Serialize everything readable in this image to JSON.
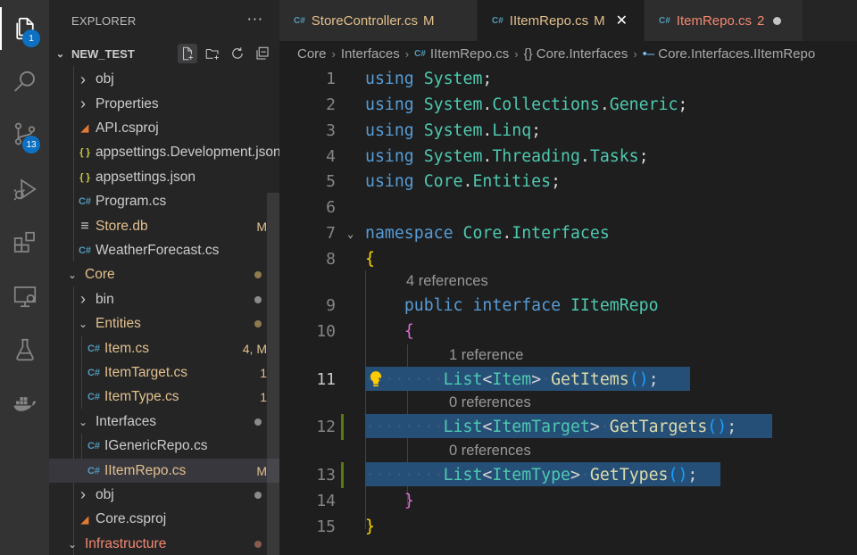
{
  "activity_bar": {
    "explorer_badge": "1",
    "source_control_badge": "13"
  },
  "sidebar": {
    "title": "EXPLORER",
    "more": "···",
    "section": "NEW_TEST",
    "items": [
      {
        "label": "obj",
        "status": ""
      },
      {
        "label": "Properties",
        "status": ""
      },
      {
        "label": "API.csproj",
        "status": ""
      },
      {
        "label": "appsettings.Development.json",
        "status": ""
      },
      {
        "label": "appsettings.json",
        "status": ""
      },
      {
        "label": "Program.cs",
        "status": ""
      },
      {
        "label": "Store.db",
        "status": "M"
      },
      {
        "label": "WeatherForecast.cs",
        "status": ""
      },
      {
        "label": "Core",
        "status": ""
      },
      {
        "label": "bin",
        "status": ""
      },
      {
        "label": "Entities",
        "status": ""
      },
      {
        "label": "Item.cs",
        "status": "4, M"
      },
      {
        "label": "ItemTarget.cs",
        "status": "1"
      },
      {
        "label": "ItemType.cs",
        "status": "1"
      },
      {
        "label": "Interfaces",
        "status": ""
      },
      {
        "label": "IGenericRepo.cs",
        "status": ""
      },
      {
        "label": "IItemRepo.cs",
        "status": "M"
      },
      {
        "label": "obj",
        "status": ""
      },
      {
        "label": "Core.csproj",
        "status": ""
      },
      {
        "label": "Infrastructure",
        "status": ""
      }
    ],
    "icon_glyphs": {
      "csharp": "C#",
      "json": "{ }"
    }
  },
  "tabs": [
    {
      "label": "StoreController.cs",
      "status": "M"
    },
    {
      "label": "IItemRepo.cs",
      "status": "M"
    },
    {
      "label": "ItemRepo.cs",
      "status": "2"
    }
  ],
  "breadcrumb": [
    "Core",
    "Interfaces",
    "IItemRepo.cs",
    "{} Core.Interfaces",
    "Core.Interfaces.IItemRepo"
  ],
  "editor": {
    "line_numbers": [
      "1",
      "2",
      "3",
      "4",
      "5",
      "6",
      "7",
      "8",
      "9",
      "10",
      "11",
      "12",
      "13",
      "14",
      "15"
    ],
    "codelens": [
      "4 references",
      "1 reference",
      "0 references",
      "0 references"
    ]
  },
  "colors": {
    "modified": "#e2c08d",
    "error": "#f48771",
    "added_gutter": "#587c0c",
    "selection": "#264f78",
    "badge": "#0e70c0"
  }
}
